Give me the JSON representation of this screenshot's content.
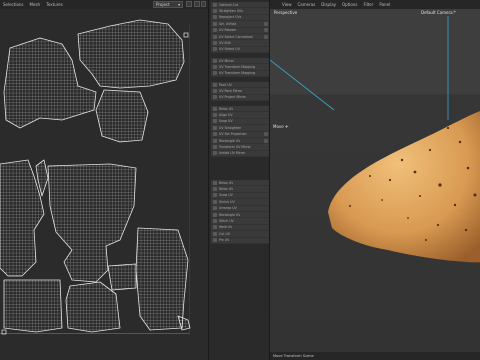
{
  "uv_editor": {
    "menu": [
      "Selections",
      "Mesh",
      "Textures"
    ],
    "mode_dropdown": "Project"
  },
  "tools": {
    "group1": [
      "Optimal Cut",
      "Straighten UVs",
      "Reproject UVs",
      "Sel. Unfold",
      "UV Relaxer",
      "UV Select Connected",
      "UV Edit",
      "UV Select UV"
    ],
    "group2": [
      "UV Mirror",
      "UV Transform Mapping",
      "UV Transform Mapping",
      "Pack UV",
      "UV Pack Mirror",
      "UV Project Mirror"
    ],
    "group3": [
      "Relax UV",
      "Align UV",
      "Snap UV",
      "UV Straighten",
      "UV Set Projection",
      "Rectangle UV",
      "Transform UV Mirror",
      "Unfold UV Mirror"
    ],
    "group4": [
      "Relax UV",
      "Relax UV",
      "Grow UV",
      "Shrink UV",
      "Unwrap UV",
      "Rectangle UV",
      "Stitch UV",
      "Weld UV",
      "Cut UV",
      "Pin UV"
    ]
  },
  "viewport": {
    "menu": [
      "View",
      "Cameras",
      "Display",
      "Options",
      "Filter",
      "Panel"
    ],
    "camera_label": "Perspective",
    "default_camera": "Default Camera:*",
    "move_label": "Move  ✛",
    "status_text": "Move Transform Scene"
  },
  "colors": {
    "uv_lines": "#d8d8d8",
    "object_skin": "#d99a52",
    "object_spots": "#5a2d12",
    "light_line": "#3aa6d0"
  }
}
